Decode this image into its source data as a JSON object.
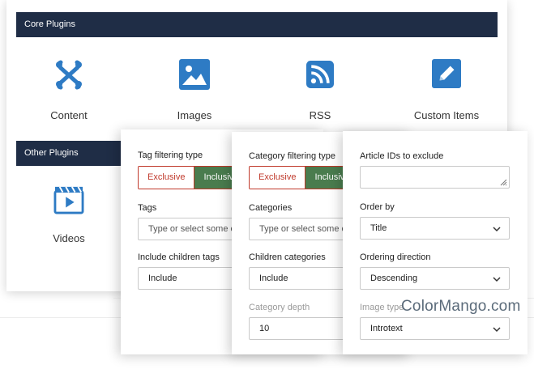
{
  "core_plugins": {
    "heading": "Core Plugins",
    "items": [
      {
        "label": "Content",
        "icon": "joomla-icon"
      },
      {
        "label": "Images",
        "icon": "image-icon"
      },
      {
        "label": "RSS",
        "icon": "rss-icon"
      },
      {
        "label": "Custom Items",
        "icon": "pencil-icon"
      }
    ]
  },
  "other_plugins": {
    "heading": "Other Plugins",
    "items": [
      {
        "label": "Videos",
        "icon": "video-icon"
      }
    ]
  },
  "tag_panel": {
    "filter_label": "Tag filtering type",
    "exclusive": "Exclusive",
    "inclusive": "Inclusive",
    "tags_label": "Tags",
    "tags_placeholder": "Type or select some options",
    "children_label": "Include children tags",
    "children_value": "Include"
  },
  "category_panel": {
    "filter_label": "Category filtering type",
    "exclusive": "Exclusive",
    "inclusive": "Inclusive",
    "categories_label": "Categories",
    "categories_placeholder": "Type or select some options",
    "children_label": "Children categories",
    "children_value": "Include",
    "depth_label": "Category depth",
    "depth_value": "10"
  },
  "article_panel": {
    "exclude_label": "Article IDs to exclude",
    "exclude_value": "",
    "order_label": "Order by",
    "order_value": "Title",
    "direction_label": "Ordering direction",
    "direction_value": "Descending",
    "image_label": "Image type",
    "image_value": "Introtext"
  },
  "watermark": "ColorMango.com",
  "colors": {
    "heading_bg": "#1f2d46",
    "icon_blue": "#2e7bc4",
    "exclusive_red": "#c0392b",
    "inclusive_green": "#4a7c4e"
  }
}
